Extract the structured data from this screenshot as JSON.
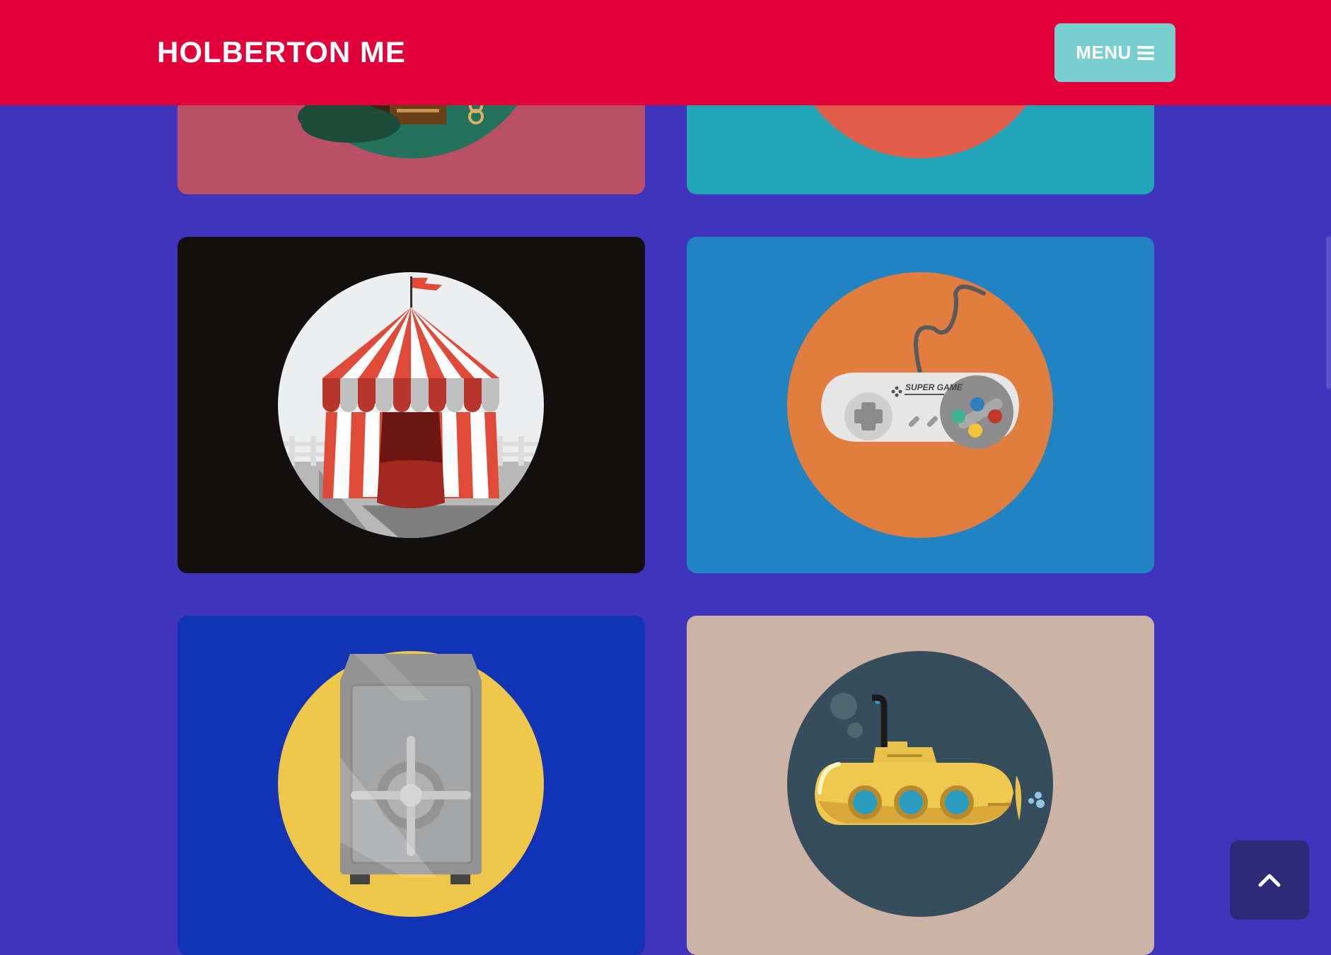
{
  "navbar": {
    "brand": "HOLBERTON ME",
    "menu_label": "MENU",
    "menu_icon": "hamburger-icon"
  },
  "portfolio": {
    "items": [
      {
        "name": "cabin",
        "icon": "cabin-icon",
        "bg": "#ba5065",
        "circle": "#22725c"
      },
      {
        "name": "sunset",
        "icon": "sun-icon",
        "bg": "#22a6b7",
        "circle": "#e15c49"
      },
      {
        "name": "circus",
        "icon": "circus-tent-icon",
        "bg": "#140f0f",
        "circle": "#eceeef"
      },
      {
        "name": "game",
        "icon": "game-controller-icon",
        "bg": "#2083c2",
        "circle": "#e17e3f"
      },
      {
        "name": "safe",
        "icon": "safe-icon",
        "bg": "#1034b5",
        "circle": "#eec64a"
      },
      {
        "name": "submarine",
        "icon": "submarine-icon",
        "bg": "#ccb3a4",
        "circle": "#354d5d"
      }
    ],
    "controller_label": "SUPER GAME"
  },
  "scroll_top": {
    "icon": "chevron-up-icon"
  },
  "colors": {
    "page_bg": "#4034bd",
    "navbar": "#e1003a",
    "menu_button": "#79cfd0",
    "scroll_top": "#2e2a79"
  }
}
